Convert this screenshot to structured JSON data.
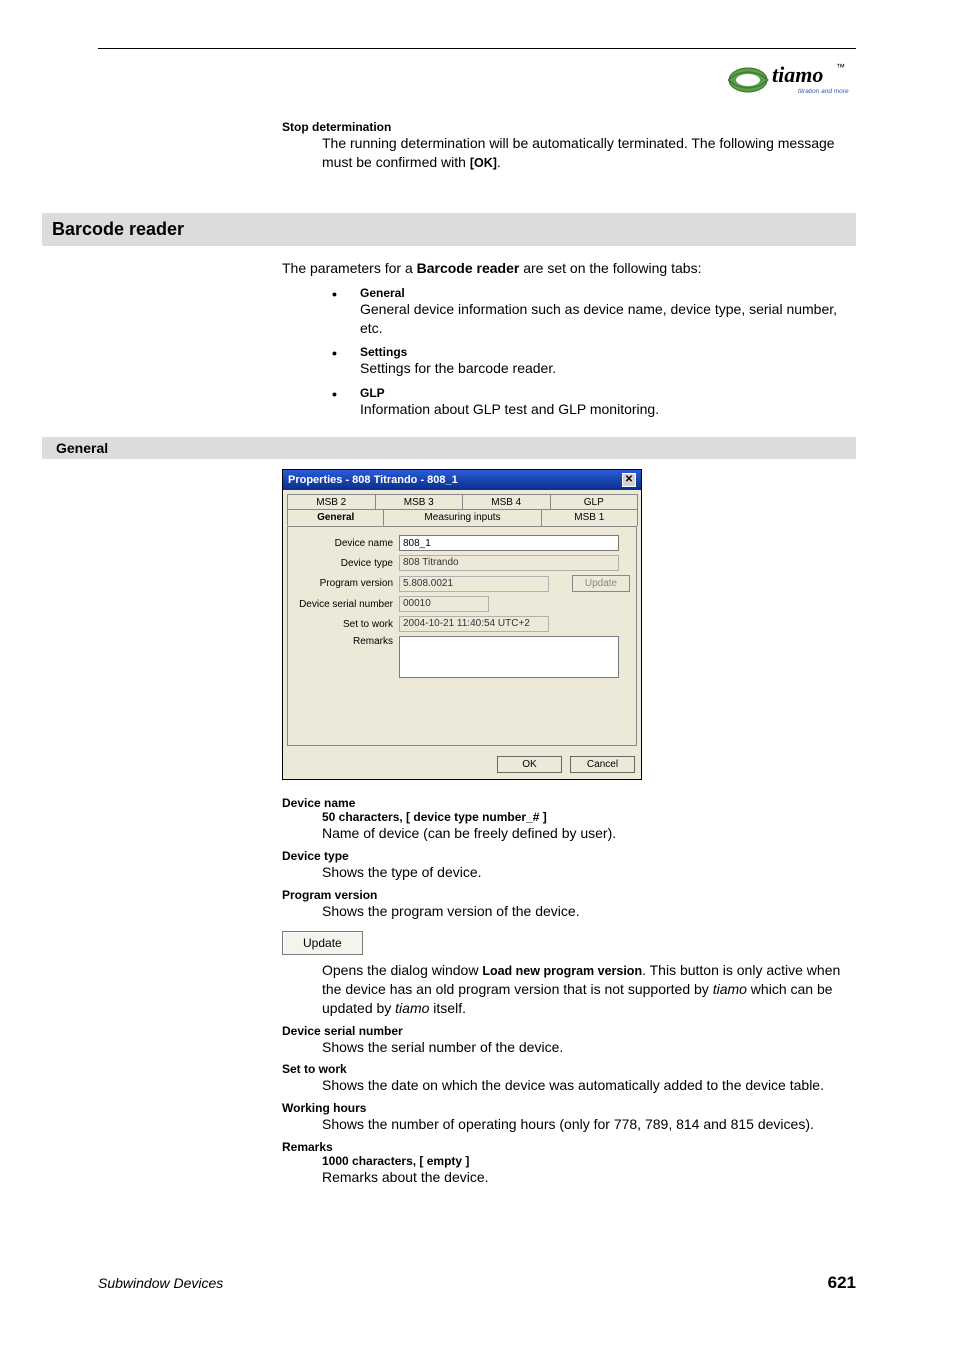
{
  "logo": {
    "brand": "tiamo",
    "tagline": "titration and more",
    "tm": "™"
  },
  "stop": {
    "title": "Stop determination",
    "body_pre": "The running determination will be automatically terminated. The following message must be confirmed with ",
    "ok": "[OK]",
    "body_post": "."
  },
  "barcode_title": "Barcode reader",
  "barcode_intro_pre": "The parameters for a ",
  "barcode_intro_bold": "Barcode reader",
  "barcode_intro_post": " are set on the following tabs:",
  "bullets": [
    {
      "title": "General",
      "desc": "General device information such as device name, device type, serial number, etc."
    },
    {
      "title": "Settings",
      "desc": "Settings for the barcode reader."
    },
    {
      "title": "GLP",
      "desc": "Information about GLP test and GLP monitoring."
    }
  ],
  "general_title": "General",
  "dialog": {
    "title": "Properties - 808 Titrando - 808_1",
    "tabs_top": [
      "MSB 2",
      "MSB 3",
      "MSB 4",
      "GLP"
    ],
    "tabs_bot": [
      "General",
      "Measuring inputs",
      "MSB 1"
    ],
    "active_tab": "General",
    "fields": {
      "device_name_label": "Device name",
      "device_name": "808_1",
      "device_type_label": "Device type",
      "device_type": "808 Titrando",
      "program_version_label": "Program version",
      "program_version": "5.808.0021",
      "update_btn": "Update",
      "serial_label": "Device serial number",
      "serial": "00010",
      "set_to_work_label": "Set to work",
      "set_to_work": "2004-10-21 11:40:54 UTC+2",
      "remarks_label": "Remarks"
    },
    "ok": "OK",
    "cancel": "Cancel"
  },
  "defs": {
    "device_name": {
      "t": "Device name",
      "sub": "50 characters, [ device type number_# ]",
      "d": "Name of device (can be freely defined by user)."
    },
    "device_type": {
      "t": "Device type",
      "d": "Shows the type of device."
    },
    "program_version": {
      "t": "Program version",
      "d": "Shows the program version of the device."
    },
    "update_btn_label": "Update",
    "update_desc_pre": "Opens the dialog window ",
    "update_desc_bold": "Load new program version",
    "update_desc_mid": ". This button is only active when the device has an old program version that is not supported by ",
    "update_desc_it1": "tiamo",
    "update_desc_mid2": " which can be updated by ",
    "update_desc_it2": "tiamo",
    "update_desc_post": " itself.",
    "serial": {
      "t": "Device serial number",
      "d": "Shows the serial number of the device."
    },
    "set_to_work": {
      "t": "Set to work",
      "d": "Shows the date on which the device was automatically added to the device table."
    },
    "working_hours": {
      "t": "Working hours",
      "d": "Shows the number of operating hours (only for 778, 789, 814 and 815 devices)."
    },
    "remarks": {
      "t": "Remarks",
      "sub": "1000 characters, [ empty ]",
      "d": "Remarks about the device."
    }
  },
  "footer": {
    "left": "Subwindow Devices",
    "right": "621"
  }
}
